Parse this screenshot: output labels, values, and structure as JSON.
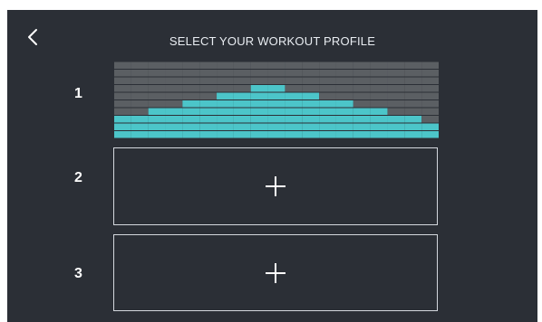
{
  "header": {
    "title": "SELECT YOUR WORKOUT PROFILE",
    "back_icon": "chevron-left-icon"
  },
  "profiles": [
    {
      "number": "1",
      "state": "configured",
      "levels": [
        3,
        3,
        4,
        4,
        5,
        5,
        6,
        6,
        7,
        7,
        6,
        6,
        5,
        5,
        4,
        4,
        3,
        3,
        2
      ],
      "max_level": 10,
      "colors": {
        "level": "#4cc5c9",
        "grid": "#5b5f63"
      }
    },
    {
      "number": "2",
      "state": "empty",
      "icon": "plus-icon"
    },
    {
      "number": "3",
      "state": "empty",
      "icon": "plus-icon"
    }
  ],
  "colors": {
    "background": "#2b2f36",
    "text": "#ffffff",
    "accent": "#4cc5c9"
  }
}
